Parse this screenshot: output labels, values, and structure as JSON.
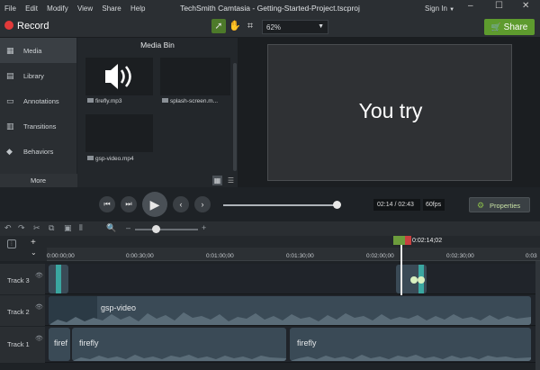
{
  "menu": [
    "File",
    "Edit",
    "Modify",
    "View",
    "Share",
    "Help"
  ],
  "window_title": "TechSmith Camtasia - Getting-Started-Project.tscproj",
  "sign_in": "Sign In",
  "record_label": "Record",
  "zoom_value": "62%",
  "share_label": "Share",
  "sidebar": {
    "items": [
      "Media",
      "Library",
      "Annotations",
      "Transitions",
      "Behaviors"
    ],
    "more": "More"
  },
  "media_bin": {
    "title": "Media Bin",
    "items": [
      "firefly.mp3",
      "splash-screen.m...",
      "gsp-video.mp4"
    ]
  },
  "canvas_text": "You try",
  "playback": {
    "time": "02:14 / 02:43",
    "fps": "60fps",
    "progress": 0.97
  },
  "properties_label": "Properties",
  "timeline": {
    "playhead_label": "0:02:14;02",
    "ticks": [
      "0:00:00;00",
      "0:00:30;00",
      "0:01:00;00",
      "0:01:30;00",
      "0:02:00;00",
      "0:02:30;00",
      "0:03"
    ],
    "tracks": [
      {
        "name": "Track 3",
        "clips": []
      },
      {
        "name": "Track 2",
        "clips": [
          "gsp-video"
        ]
      },
      {
        "name": "Track 1",
        "clips": [
          "firef",
          "firefly",
          "firefly"
        ]
      }
    ]
  },
  "colors": {
    "accent_green": "#5e9b2e",
    "clip_blue": "#3a4a56",
    "record_red": "#e23a3a"
  }
}
